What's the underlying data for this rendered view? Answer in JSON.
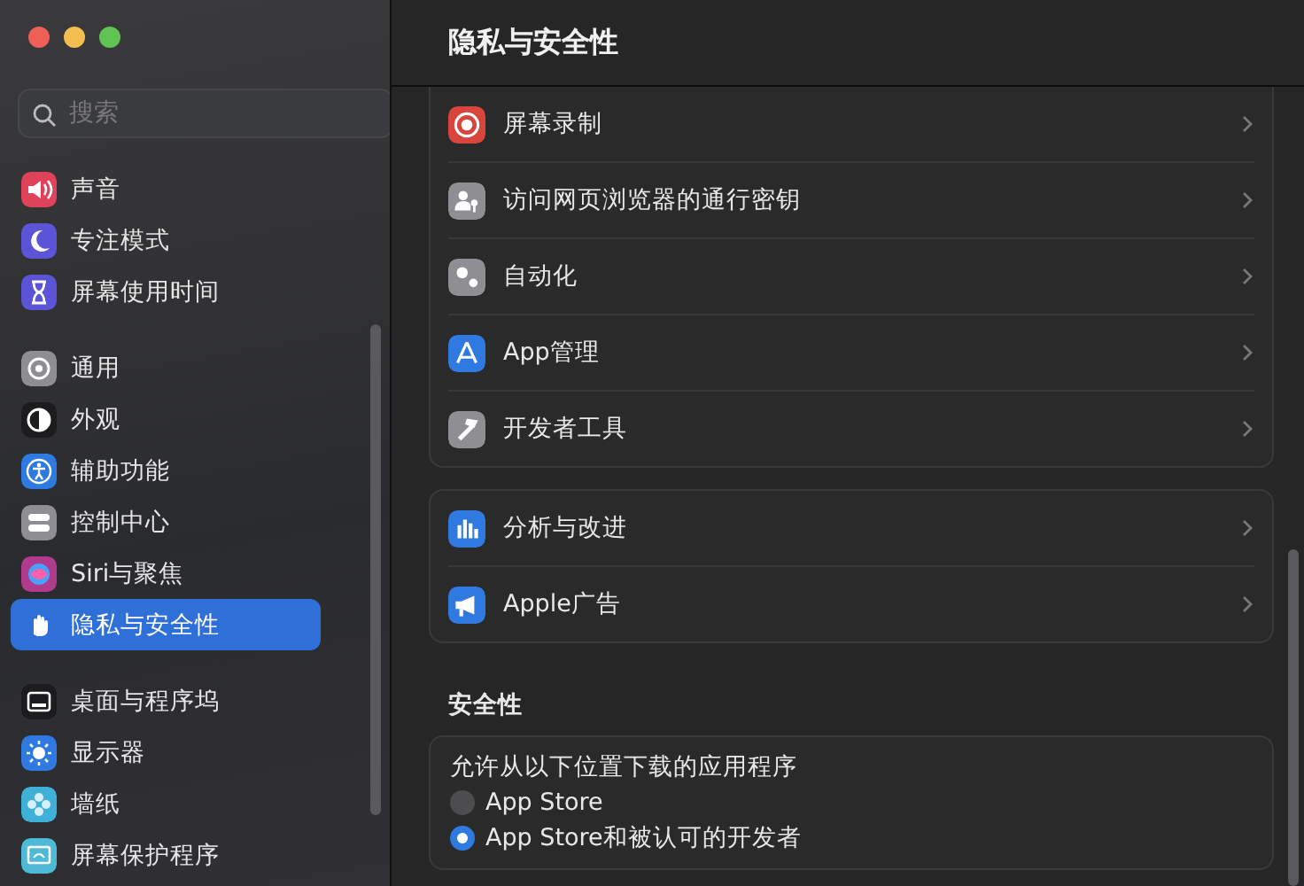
{
  "search": {
    "placeholder": "搜索"
  },
  "sidebar": {
    "groups": [
      {
        "items": [
          {
            "label": "声音",
            "color": "#e0425a",
            "selected": false
          },
          {
            "label": "专注模式",
            "color": "#5b54d6",
            "selected": false
          },
          {
            "label": "屏幕使用时间",
            "color": "#5b54d6",
            "selected": false
          }
        ]
      },
      {
        "items": [
          {
            "label": "通用",
            "color": "#8e8e93",
            "selected": false
          },
          {
            "label": "外观",
            "color": "#1c1c1e",
            "selected": false
          },
          {
            "label": "辅助功能",
            "color": "#2f7ae0",
            "selected": false
          },
          {
            "label": "控制中心",
            "color": "#8e8e93",
            "selected": false
          },
          {
            "label": "Siri与聚焦",
            "color": "#b03a8c",
            "selected": false
          },
          {
            "label": "隐私与安全性",
            "selected": true
          }
        ]
      },
      {
        "items": [
          {
            "label": "桌面与程序坞",
            "color": "#1c1c1e",
            "selected": false
          },
          {
            "label": "显示器",
            "color": "#2f7ae0",
            "selected": false
          },
          {
            "label": "墙纸",
            "color": "#3fb0d8",
            "selected": false
          },
          {
            "label": "屏幕保护程序",
            "color": "#4fbad8",
            "selected": false
          }
        ]
      }
    ]
  },
  "page": {
    "title": "隐私与安全性",
    "groups": [
      {
        "rows": [
          {
            "label": "屏幕录制",
            "color": "#d9443c"
          },
          {
            "label": "访问网页浏览器的通行密钥",
            "color": "#8e8e93"
          },
          {
            "label": "自动化",
            "color": "#8e8e93"
          },
          {
            "label": "App管理",
            "color": "#2f7ae0"
          },
          {
            "label": "开发者工具",
            "color": "#8e8e93"
          }
        ]
      },
      {
        "rows": [
          {
            "label": "分析与改进",
            "color": "#2f7ae0"
          },
          {
            "label": "Apple广告",
            "color": "#2f7ae0"
          }
        ]
      }
    ],
    "security": {
      "heading": "安全性",
      "prompt": "允许从以下位置下载的应用程序",
      "options": [
        {
          "label": "App Store",
          "selected": false
        },
        {
          "label": "App Store和被认可的开发者",
          "selected": true
        }
      ]
    }
  }
}
